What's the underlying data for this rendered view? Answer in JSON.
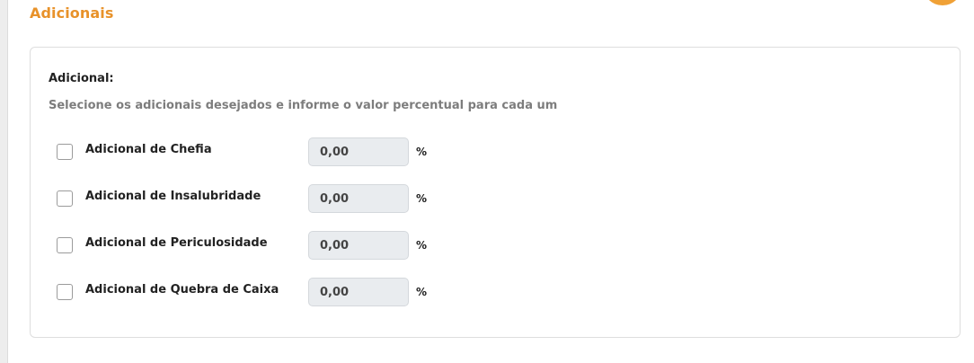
{
  "section": {
    "title": "Adicionais"
  },
  "panel": {
    "label": "Adicional:",
    "hint": "Selecione os adicionais desejados e informe o valor percentual para cada um"
  },
  "items": [
    {
      "label": "Adicional de Chefia",
      "value": "0,00",
      "unit": "%",
      "checked": false
    },
    {
      "label": "Adicional de Insalubridade",
      "value": "0,00",
      "unit": "%",
      "checked": false
    },
    {
      "label": "Adicional de Periculosidade",
      "value": "0,00",
      "unit": "%",
      "checked": false
    },
    {
      "label": "Adicional de Quebra de Caixa",
      "value": "0,00",
      "unit": "%",
      "checked": false
    }
  ],
  "colors": {
    "accent": "#e8922a",
    "input_bg": "#e9ecef",
    "border": "#dedede"
  }
}
